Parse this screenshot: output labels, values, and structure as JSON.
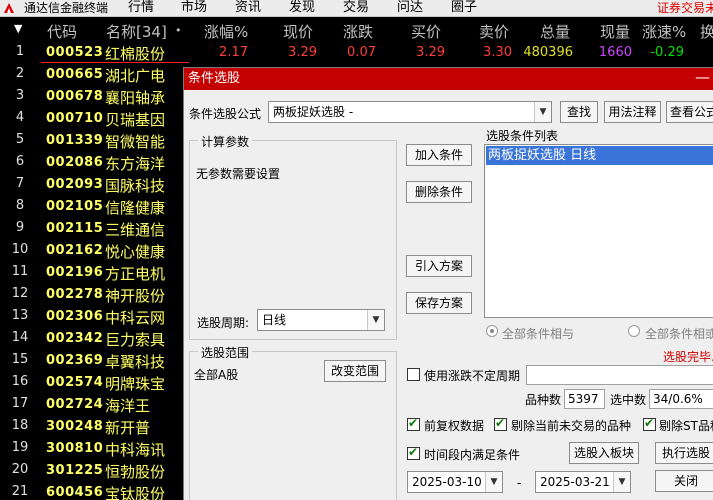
{
  "menubar": {
    "app_title": "通达信金融终端",
    "items": [
      "行情",
      "市场",
      "资讯",
      "发现",
      "交易",
      "问达",
      "圈子"
    ],
    "right_text": "证券交易未",
    "logo_color": "#e00000"
  },
  "columns": [
    "代码",
    "名称[34]",
    "•",
    "涨幅%",
    "现价",
    "涨跌",
    "买价",
    "卖价",
    "总量",
    "现量",
    "涨速%",
    "换"
  ],
  "rows": [
    {
      "idx": "1",
      "code": "000523",
      "name": "红棉股份",
      "change_pct": "2.17",
      "price": "3.29",
      "change": "0.07",
      "bid": "3.29",
      "ask": "3.30",
      "volume": "480396",
      "cur_vol": "1660",
      "speed": "-0.29"
    },
    {
      "idx": "2",
      "code": "000665",
      "name": "湖北广电"
    },
    {
      "idx": "3",
      "code": "000678",
      "name": "襄阳轴承"
    },
    {
      "idx": "4",
      "code": "000710",
      "name": "贝瑞基因"
    },
    {
      "idx": "5",
      "code": "001339",
      "name": "智微智能"
    },
    {
      "idx": "6",
      "code": "002086",
      "name": "东方海洋"
    },
    {
      "idx": "7",
      "code": "002093",
      "name": "国脉科技"
    },
    {
      "idx": "8",
      "code": "002105",
      "name": "信隆健康"
    },
    {
      "idx": "9",
      "code": "002115",
      "name": "三维通信"
    },
    {
      "idx": "10",
      "code": "002162",
      "name": "悦心健康"
    },
    {
      "idx": "11",
      "code": "002196",
      "name": "方正电机"
    },
    {
      "idx": "12",
      "code": "002278",
      "name": "神开股份"
    },
    {
      "idx": "13",
      "code": "002306",
      "name": "中科云网"
    },
    {
      "idx": "14",
      "code": "002342",
      "name": "巨力索具"
    },
    {
      "idx": "15",
      "code": "002369",
      "name": "卓翼科技"
    },
    {
      "idx": "16",
      "code": "002574",
      "name": "明牌珠宝"
    },
    {
      "idx": "17",
      "code": "002724",
      "name": "海洋王"
    },
    {
      "idx": "18",
      "code": "300248",
      "name": "新开普"
    },
    {
      "idx": "19",
      "code": "300810",
      "name": "中科海讯"
    },
    {
      "idx": "20",
      "code": "301225",
      "name": "恒勃股份"
    },
    {
      "idx": "21",
      "code": "600456",
      "name": "宝钛股份"
    }
  ],
  "dialog": {
    "title": "条件选股",
    "formula_label": "条件选股公式",
    "formula_value": "两板捉妖选股 -",
    "btn_find": "查找",
    "btn_usage": "用法注释",
    "btn_view": "查看公式",
    "params_title": "计算参数",
    "no_params": "无参数需要设置",
    "period_label": "选股周期:",
    "period_value": "日线",
    "btn_add": "加入条件",
    "btn_delete": "删除条件",
    "btn_import": "引入方案",
    "btn_save": "保存方案",
    "list_title": "选股条件列表",
    "list_item": "两板捉妖选股  日线",
    "radio_and": "全部条件相与",
    "radio_or": "全部条件相或",
    "status": "选股完毕.",
    "scope_title": "选股范围",
    "scope_value": "全部A股",
    "btn_change_scope": "改变范围",
    "chk_uncertain": "使用涨跌不定周期",
    "count_label": "品种数",
    "count_value": "5397",
    "selected_label": "选中数",
    "selected_value": "34/0.6%",
    "chk_adjust": "前复权数据",
    "chk_exclude_untraded": "剔除当前未交易的品种",
    "chk_exclude_st": "剔除ST品种",
    "chk_time": "时间段内满足条件",
    "btn_to_block": "选股入板块",
    "btn_execute": "执行选股",
    "date_from": "2025-03-10",
    "date_sep": "-",
    "date_to": "2025-03-21",
    "btn_close": "关闭"
  },
  "colors": {
    "header_gray": "#c0c0c0",
    "code_yellow": "#ffff66",
    "up_red": "#ff3c3c",
    "down_green": "#00e000",
    "volume_yellow": "#e0e020",
    "curvol_purple": "#cc44ff",
    "title_red": "#c40000",
    "selection_blue": "#3a74d8"
  }
}
